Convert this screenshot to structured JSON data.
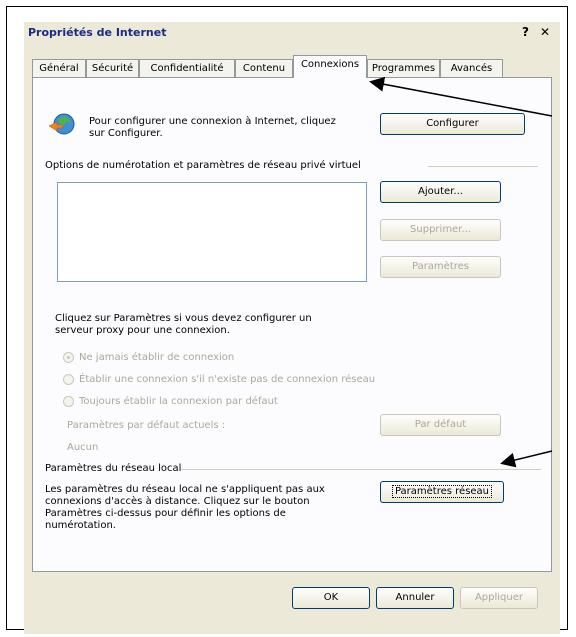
{
  "window": {
    "title": "Propriétés de Internet",
    "help": "?",
    "close": "✕"
  },
  "tabs": [
    {
      "label": "Général"
    },
    {
      "label": "Sécurité"
    },
    {
      "label": "Confidentialité"
    },
    {
      "label": "Contenu"
    },
    {
      "label": "Connexions"
    },
    {
      "label": "Programmes"
    },
    {
      "label": "Avancés"
    }
  ],
  "setup": {
    "text_line1": "Pour configurer une connexion à Internet, cliquez",
    "text_line2": "sur Configurer.",
    "button": "Configurer"
  },
  "dialup": {
    "section_title": "Options de numérotation et paramètres de réseau privé virtuel",
    "add_button": "Ajouter...",
    "remove_button": "Supprimer...",
    "settings_button": "Paramètres",
    "info_line1": "Cliquez sur Paramètres si vous devez configurer un",
    "info_line2": "serveur proxy pour une connexion.",
    "options": [
      {
        "label": "Ne jamais établir de connexion"
      },
      {
        "label": "Établir une connexion s'il n'existe pas de connexion réseau"
      },
      {
        "label": "Toujours établir la connexion par défaut"
      }
    ],
    "current_default_label": "Paramètres par défaut actuels :",
    "current_default_value": "Aucun",
    "default_button": "Par défaut"
  },
  "lan": {
    "section_title": "Paramètres du réseau local",
    "text_line1": "Les paramètres du réseau local ne s'appliquent pas aux",
    "text_line2": "connexions d'accès à distance. Cliquez sur le bouton",
    "text_line3": "Paramètres ci-dessus pour définir les options de",
    "text_line4": "numérotation.",
    "button": "Paramètres réseau"
  },
  "footer": {
    "ok": "OK",
    "cancel": "Annuler",
    "apply": "Appliquer"
  },
  "colors": {
    "title": "#1b2a85",
    "dialog_bg": "#ece9d8",
    "panel_bg": "#fcfcfe",
    "disabled": "#aca899"
  }
}
